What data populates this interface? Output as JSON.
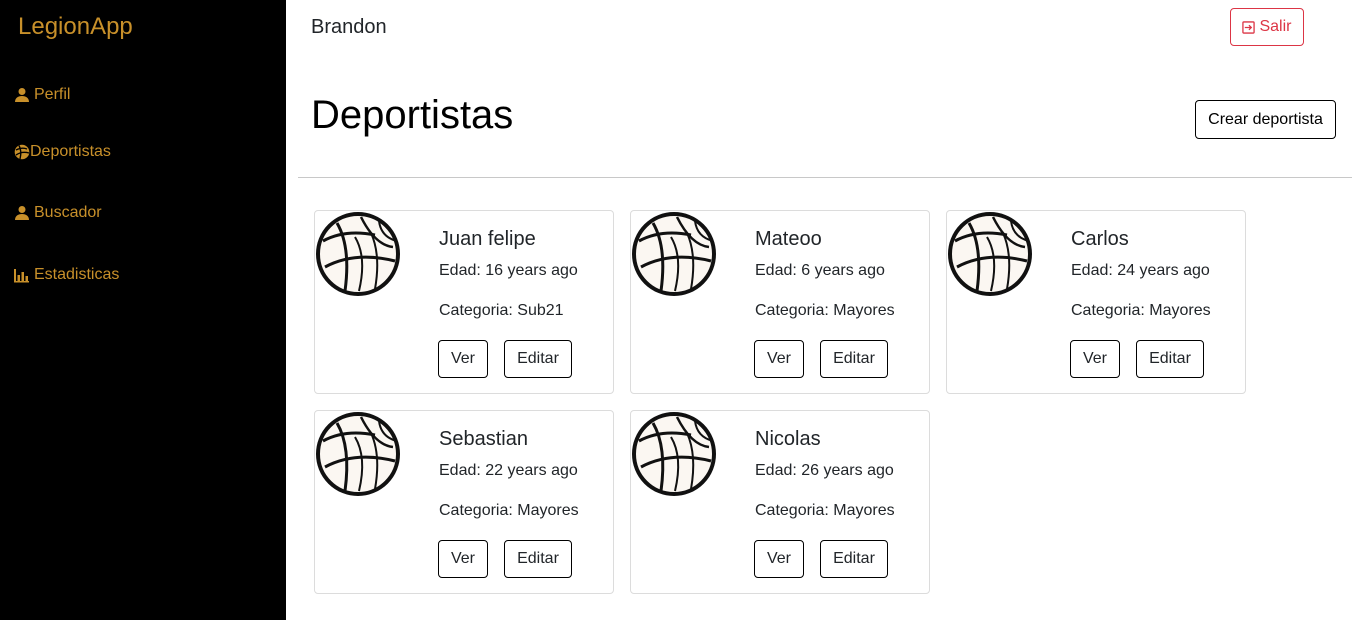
{
  "app": {
    "brand": "LegionApp",
    "accent_color": "#c8902a",
    "sidebar_bg": "#000000"
  },
  "sidebar": {
    "items": [
      {
        "label": "Perfil",
        "icon": "user-icon"
      },
      {
        "label": "Deportistas",
        "icon": "volleyball-icon"
      },
      {
        "label": "Buscador",
        "icon": "user-icon"
      },
      {
        "label": "Estadisticas",
        "icon": "bar-chart-icon"
      }
    ]
  },
  "header": {
    "username": "Brandon",
    "logout_label": "Salir",
    "logout_icon": "sign-out-icon",
    "logout_color": "#dc3545"
  },
  "main": {
    "title": "Deportistas",
    "create_label": "Crear deportista",
    "athletes": [
      {
        "name": "Juan felipe",
        "edad": "Edad: 16 years ago",
        "categoria": "Categoria: Sub21",
        "ver_label": "Ver",
        "edit_label": "Editar"
      },
      {
        "name": "Mateoo",
        "edad": "Edad: 6 years ago",
        "categoria": "Categoria: Mayores",
        "ver_label": "Ver",
        "edit_label": "Editar"
      },
      {
        "name": "Carlos",
        "edad": "Edad: 24 years ago",
        "categoria": "Categoria: Mayores",
        "ver_label": "Ver",
        "edit_label": "Editar"
      },
      {
        "name": "Sebastian",
        "edad": "Edad: 22 years ago",
        "categoria": "Categoria: Mayores",
        "ver_label": "Ver",
        "edit_label": "Editar"
      },
      {
        "name": "Nicolas",
        "edad": "Edad: 26 years ago",
        "categoria": "Categoria: Mayores",
        "ver_label": "Ver",
        "edit_label": "Editar"
      }
    ]
  }
}
